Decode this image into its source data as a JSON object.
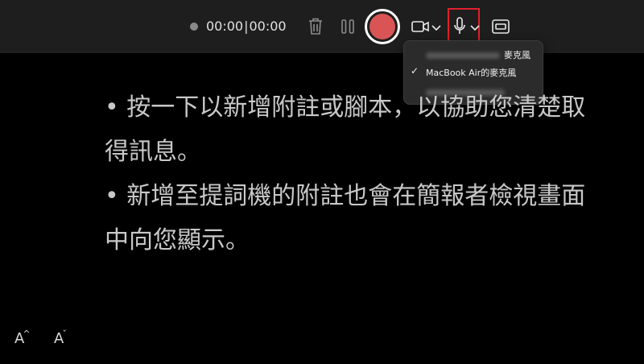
{
  "toolbar": {
    "timer_elapsed": "00:00",
    "timer_separator": "|",
    "timer_total": "00:00",
    "record_color": "#d95454",
    "mic_highlight_color": "#e0202c"
  },
  "mic_menu": {
    "items": [
      {
        "label": "麥克風",
        "selected": false,
        "redacted": true
      },
      {
        "label": "MacBook Air的麥克風",
        "selected": true,
        "redacted": false
      },
      {
        "label": "",
        "selected": false,
        "redacted": true
      }
    ],
    "check_glyph": "✓"
  },
  "notes": {
    "paragraphs": [
      "• 按一下以新增附註或腳本，以協助您清楚取得訊息。",
      "• 新增至提詞機的附註也會在簡報者檢視畫面中向您顯示。"
    ]
  },
  "font_controls": {
    "increase_label": "A",
    "increase_mark": "^",
    "decrease_label": "A",
    "decrease_mark": "ˇ"
  }
}
